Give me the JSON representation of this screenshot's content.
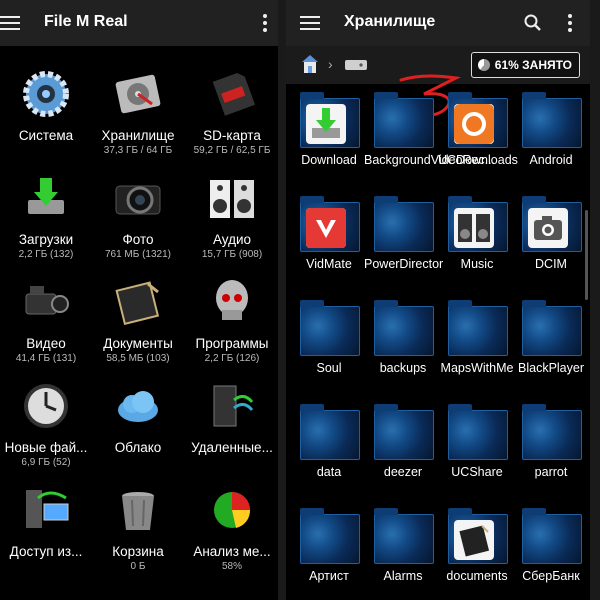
{
  "left_app": {
    "title": "File M Real",
    "tiles": [
      {
        "label": "Система",
        "sub": "",
        "icon": "gear-icon"
      },
      {
        "label": "Хранилище",
        "sub": "37,3 ГБ / 64 ГБ",
        "icon": "hard-drive-icon"
      },
      {
        "label": "SD-карта",
        "sub": "59,2 ГБ / 62,5 ГБ",
        "icon": "sd-card-icon"
      },
      {
        "label": "Загрузки",
        "sub": "2,2 ГБ (132)",
        "icon": "download-icon"
      },
      {
        "label": "Фото",
        "sub": "761 МБ (1321)",
        "icon": "camera-icon"
      },
      {
        "label": "Аудио",
        "sub": "15,7 ГБ (908)",
        "icon": "speakers-icon"
      },
      {
        "label": "Видео",
        "sub": "41,4 ГБ (131)",
        "icon": "video-camera-icon"
      },
      {
        "label": "Документы",
        "sub": "58,5 МБ (103)",
        "icon": "notebook-icon"
      },
      {
        "label": "Программы",
        "sub": "2,2 ГБ (126)",
        "icon": "robot-skull-icon"
      },
      {
        "label": "Новые фай...",
        "sub": "6,9 ГБ (52)",
        "icon": "clock-icon"
      },
      {
        "label": "Облако",
        "sub": "",
        "icon": "cloud-icon"
      },
      {
        "label": "Удаленные...",
        "sub": "",
        "icon": "server-icon"
      },
      {
        "label": "Доступ из...",
        "sub": "",
        "icon": "network-computer-icon"
      },
      {
        "label": "Корзина",
        "sub": "0 Б",
        "icon": "trash-icon"
      },
      {
        "label": "Анализ ме...",
        "sub": "58%",
        "icon": "pie-chart-icon"
      }
    ]
  },
  "right_app": {
    "title": "Хранилище",
    "usage_label": "61% ЗАНЯТО",
    "usage_fraction": 0.61,
    "annotation": "3",
    "folders": [
      {
        "name": "Download",
        "overlay": "download-app-icon"
      },
      {
        "name": "BackgroundVideoRec...",
        "overlay": ""
      },
      {
        "name": "UCDownloads",
        "overlay": "uc-browser-icon"
      },
      {
        "name": "Android",
        "overlay": ""
      },
      {
        "name": "VidMate",
        "overlay": "vidmate-icon"
      },
      {
        "name": "PowerDirector",
        "overlay": ""
      },
      {
        "name": "Music",
        "overlay": "speakers-app-icon"
      },
      {
        "name": "DCIM",
        "overlay": "camera-app-icon"
      },
      {
        "name": "Soul",
        "overlay": ""
      },
      {
        "name": "backups",
        "overlay": ""
      },
      {
        "name": "MapsWithMe",
        "overlay": ""
      },
      {
        "name": "BlackPlayer",
        "overlay": ""
      },
      {
        "name": "data",
        "overlay": ""
      },
      {
        "name": "deezer",
        "overlay": ""
      },
      {
        "name": "UCShare",
        "overlay": ""
      },
      {
        "name": "parrot",
        "overlay": ""
      },
      {
        "name": "Артист",
        "overlay": ""
      },
      {
        "name": "Alarms",
        "overlay": ""
      },
      {
        "name": "documents",
        "overlay": "notebook-app-icon"
      },
      {
        "name": "СберБанк",
        "overlay": ""
      }
    ]
  }
}
